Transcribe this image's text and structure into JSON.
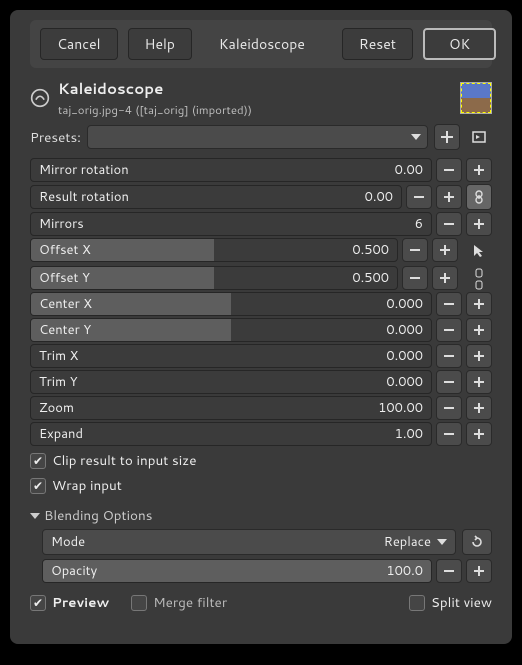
{
  "buttons": {
    "cancel": "Cancel",
    "help": "Help",
    "name": "Kaleidoscope",
    "reset": "Reset",
    "ok": "OK"
  },
  "header": {
    "title": "Kaleidoscope",
    "subtitle": "taj_orig.jpg-4 ([taj_orig] (imported))"
  },
  "presets": {
    "label": "Presets:"
  },
  "params": {
    "mirror_rotation": {
      "label": "Mirror rotation",
      "value": "0.00",
      "fill": 0
    },
    "result_rotation": {
      "label": "Result rotation",
      "value": "0.00",
      "fill": 0
    },
    "mirrors": {
      "label": "Mirrors",
      "value": "6",
      "fill": 0
    },
    "offset_x": {
      "label": "Offset X",
      "value": "0.500",
      "fill": 50
    },
    "offset_y": {
      "label": "Offset Y",
      "value": "0.500",
      "fill": 50
    },
    "center_x": {
      "label": "Center X",
      "value": "0.000",
      "fill": 50
    },
    "center_y": {
      "label": "Center Y",
      "value": "0.000",
      "fill": 50
    },
    "trim_x": {
      "label": "Trim X",
      "value": "0.000",
      "fill": 0
    },
    "trim_y": {
      "label": "Trim Y",
      "value": "0.000",
      "fill": 0
    },
    "zoom": {
      "label": "Zoom",
      "value": "100.00",
      "fill": 0
    },
    "expand": {
      "label": "Expand",
      "value": "1.00",
      "fill": 0
    }
  },
  "checks": {
    "clip": {
      "label": "Clip result to input size",
      "on": true
    },
    "wrap": {
      "label": "Wrap input",
      "on": true
    }
  },
  "blending": {
    "section": "Blending Options",
    "mode_label": "Mode",
    "mode_value": "Replace",
    "opacity_label": "Opacity",
    "opacity_value": "100.0"
  },
  "footer": {
    "preview": {
      "label": "Preview",
      "on": true
    },
    "merge": {
      "label": "Merge filter",
      "on": false
    },
    "split": {
      "label": "Split view",
      "on": false
    }
  }
}
